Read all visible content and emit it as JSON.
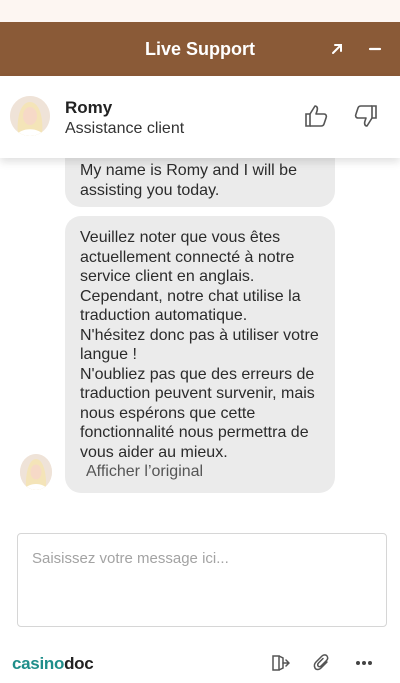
{
  "header": {
    "title": "Live Support",
    "expand_icon": "expand-arrow-icon",
    "minimize_icon": "minimize-icon",
    "background": "#8a5a37"
  },
  "agent": {
    "name": "Romy",
    "role": "Assistance client",
    "thumbs_up_icon": "thumbs-up-icon",
    "thumbs_down_icon": "thumbs-down-icon"
  },
  "messages": [
    {
      "text": "My name is Romy and I will be assisting you today."
    },
    {
      "text": "Veuillez noter que vous êtes actuellement connecté à notre service client en anglais. Cependant, notre chat utilise la traduction automatique.\nN'hésitez donc pas à utiliser votre langue !\nN'oubliez pas que des erreurs de traduction peuvent survenir, mais nous espérons que cette fonctionnalité nous permettra de vous aider au mieux.",
      "show_original": "Afficher l’original"
    }
  ],
  "composer": {
    "placeholder": "Saisissez votre message ici...",
    "value": ""
  },
  "footer": {
    "brand_part1": "casino",
    "brand_part2": "doc",
    "brand_color": "#1f8e8a",
    "icons": [
      "exit-icon",
      "paperclip-icon",
      "more-icon"
    ]
  }
}
